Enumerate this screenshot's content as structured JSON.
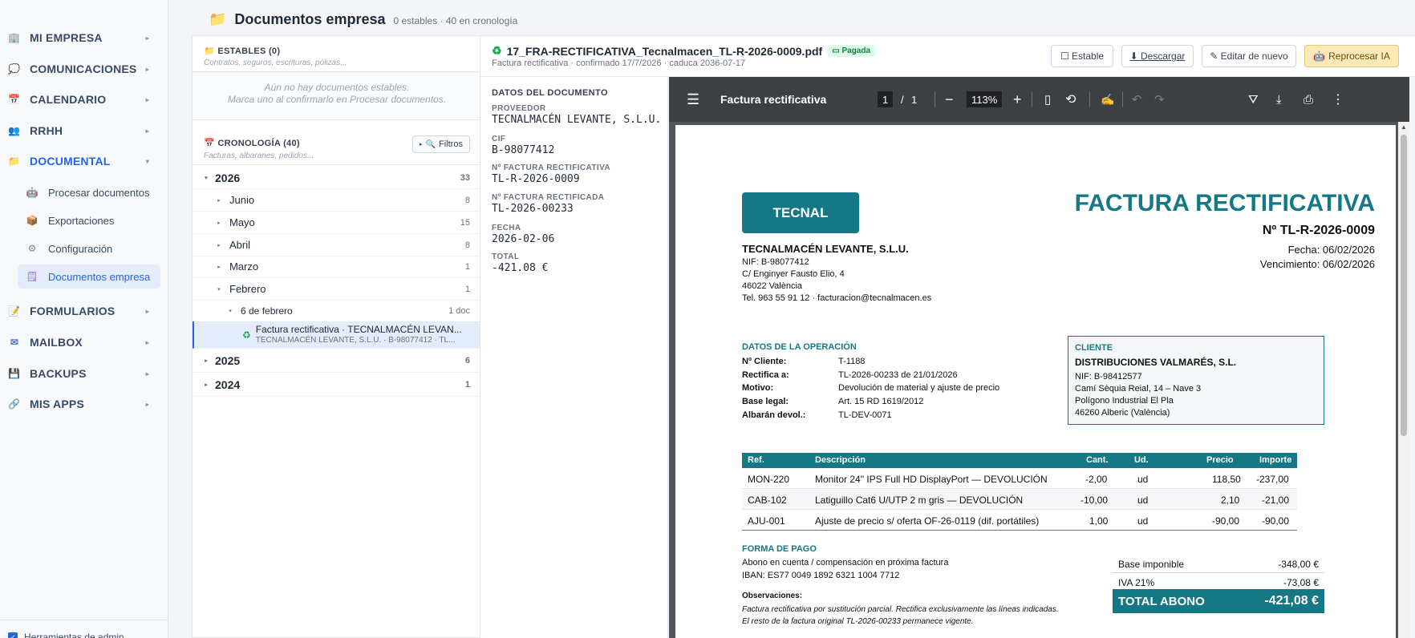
{
  "sidebar": {
    "items": [
      {
        "label": "MI EMPRESA",
        "icon": "building-icon"
      },
      {
        "label": "COMUNICACIONES",
        "icon": "chat-bubble-icon"
      },
      {
        "label": "CALENDARIO",
        "icon": "calendar-icon"
      },
      {
        "label": "RRHH",
        "icon": "people-icon"
      },
      {
        "label": "DOCUMENTAL",
        "icon": "folder-icon",
        "active": true
      },
      {
        "label": "FORMULARIOS",
        "icon": "form-icon"
      },
      {
        "label": "MAILBOX",
        "icon": "mailbox-icon"
      },
      {
        "label": "BACKUPS",
        "icon": "floppy-disk-icon"
      },
      {
        "label": "MIS APPS",
        "icon": "link-icon"
      }
    ],
    "sub_items": [
      {
        "label": "Procesar documentos",
        "icon": "robot-icon"
      },
      {
        "label": "Exportaciones",
        "icon": "package-icon"
      },
      {
        "label": "Configuración",
        "icon": "gear-icon"
      },
      {
        "label": "Documentos empresa",
        "icon": "document-icon",
        "active": true
      }
    ],
    "admin_tools_label": "Herramientas de admin"
  },
  "header": {
    "title": "Documentos empresa",
    "stats": "0 estables · 40 en cronología"
  },
  "stable": {
    "title": "ESTABLES (0)",
    "subtitle": "Contratos, seguros, escrituras, pólizas...",
    "empty_line1": "Aún no hay documentos estables.",
    "empty_line2": "Marca uno al confirmarlo en Procesar documentos."
  },
  "chronology": {
    "title": "CRONOLOGÍA (40)",
    "subtitle": "Facturas, albaranes, pedidos...",
    "filters_label": "Filtros",
    "tree": {
      "y2026": {
        "label": "2026",
        "count": "33"
      },
      "junio": {
        "label": "Junio",
        "count": "8"
      },
      "mayo": {
        "label": "Mayo",
        "count": "15"
      },
      "abril": {
        "label": "Abril",
        "count": "8"
      },
      "marzo": {
        "label": "Marzo",
        "count": "1"
      },
      "febrero": {
        "label": "Febrero",
        "count": "1"
      },
      "day": {
        "label": "6 de febrero",
        "count": "1 doc"
      },
      "doc": {
        "line1": "Factura rectificativa · TECNALMACÉN LEVAN...",
        "line2": "TECNALMACÉN LEVANTE, S.L.U. · B-98077412 · TL..."
      },
      "y2025": {
        "label": "2025",
        "count": "6"
      },
      "y2024": {
        "label": "2024",
        "count": "1"
      }
    }
  },
  "document": {
    "filename": "17_FRA-RECTIFICATIVA_Tecnalmacen_TL-R-2026-0009.pdf",
    "status": "Pagada",
    "subtitle": "Factura rectificativa · confirmado 17/7/2026 · caduca 2036-07-17",
    "actions": {
      "stable": "☐ Estable",
      "download": "⬇ Descargar",
      "edit": "✎ Editar de nuevo",
      "reprocess": "Reprocesar IA"
    }
  },
  "metadata": {
    "section_title": "DATOS DEL DOCUMENTO",
    "fields": [
      {
        "label": "PROVEEDOR",
        "value": "TECNALMACÉN LEVANTE, S.L.U."
      },
      {
        "label": "CIF",
        "value": "B-98077412"
      },
      {
        "label": "Nº FACTURA RECTIFICATIVA",
        "value": "TL-R-2026-0009"
      },
      {
        "label": "Nº FACTURA RECTIFICADA",
        "value": "TL-2026-00233"
      },
      {
        "label": "FECHA",
        "value": "2026-02-06"
      },
      {
        "label": "TOTAL",
        "value": "-421.08 €"
      }
    ]
  },
  "pdf_viewer": {
    "title": "Factura rectificativa",
    "page_current": "1",
    "page_total": "1",
    "zoom": "113%"
  },
  "invoice": {
    "logo_text": "TECNAL",
    "title": "FACTURA RECTIFICATIVA",
    "number": "Nº TL-R-2026-0009",
    "date": "Fecha: 06/02/2026",
    "due": "Vencimiento: 06/02/2026",
    "issuer": {
      "name": "TECNALMACÉN LEVANTE, S.L.U.",
      "nif": "NIF: B-98077412",
      "address": "C/ Enginyer Fausto Elio, 4",
      "city": "46022 València",
      "contact": "Tel. 963 55 91 12 · facturacion@tecnalmacen.es"
    },
    "operation": {
      "title": "DATOS DE LA OPERACIÓN",
      "rows": [
        {
          "label": "Nº Cliente:",
          "value": "T-1188"
        },
        {
          "label": "Rectifica a:",
          "value": "TL-2026-00233 de 21/01/2026"
        },
        {
          "label": "Motivo:",
          "value": "Devolución de material y ajuste de precio"
        },
        {
          "label": "Base legal:",
          "value": "Art. 15 RD 1619/2012"
        },
        {
          "label": "Albarán devol.:",
          "value": "TL-DEV-0071"
        }
      ]
    },
    "client": {
      "title": "CLIENTE",
      "name": "DISTRIBUCIONES VALMARÉS, S.L.",
      "nif": "NIF: B-98412577",
      "address": "Camí Sèquia Reial, 14 – Nave 3",
      "area": "Polígono Industrial El Pla",
      "city": "46260 Alberic (València)"
    },
    "table": {
      "headers": {
        "ref": "Ref.",
        "desc": "Descripción",
        "qty": "Cant.",
        "unit": "Ud.",
        "price": "Precio",
        "amount": "Importe"
      },
      "rows": [
        {
          "ref": "MON-220",
          "desc": "Monitor 24\" IPS Full HD DisplayPort — DEVOLUCIÓN",
          "qty": "-2,00",
          "unit": "ud",
          "price": "118,50",
          "amount": "-237,00"
        },
        {
          "ref": "CAB-102",
          "desc": "Latiguillo Cat6 U/UTP 2 m gris — DEVOLUCIÓN",
          "qty": "-10,00",
          "unit": "ud",
          "price": "2,10",
          "amount": "-21,00"
        },
        {
          "ref": "AJU-001",
          "desc": "Ajuste de precio s/ oferta OF-26-0119 (dif. portátiles)",
          "qty": "1,00",
          "unit": "ud",
          "price": "-90,00",
          "amount": "-90,00"
        }
      ]
    },
    "payment": {
      "title": "FORMA DE PAGO",
      "line1": "Abono en cuenta / compensación en próxima factura",
      "line2": "IBAN: ES77 0049 1892 6321 1004 7712"
    },
    "observations": {
      "title": "Observaciones:",
      "line1": "Factura rectificativa por sustitución parcial. Rectifica exclusivamente las líneas indicadas.",
      "line2": "El resto de la factura original TL-2026-00233 permanece vigente."
    },
    "totals": {
      "base_label": "Base imponible",
      "base_value": "-348,00 €",
      "iva_label": "IVA 21%",
      "iva_value": "-73,08 €",
      "total_label": "TOTAL ABONO",
      "total_value": "-421,08 €"
    }
  }
}
